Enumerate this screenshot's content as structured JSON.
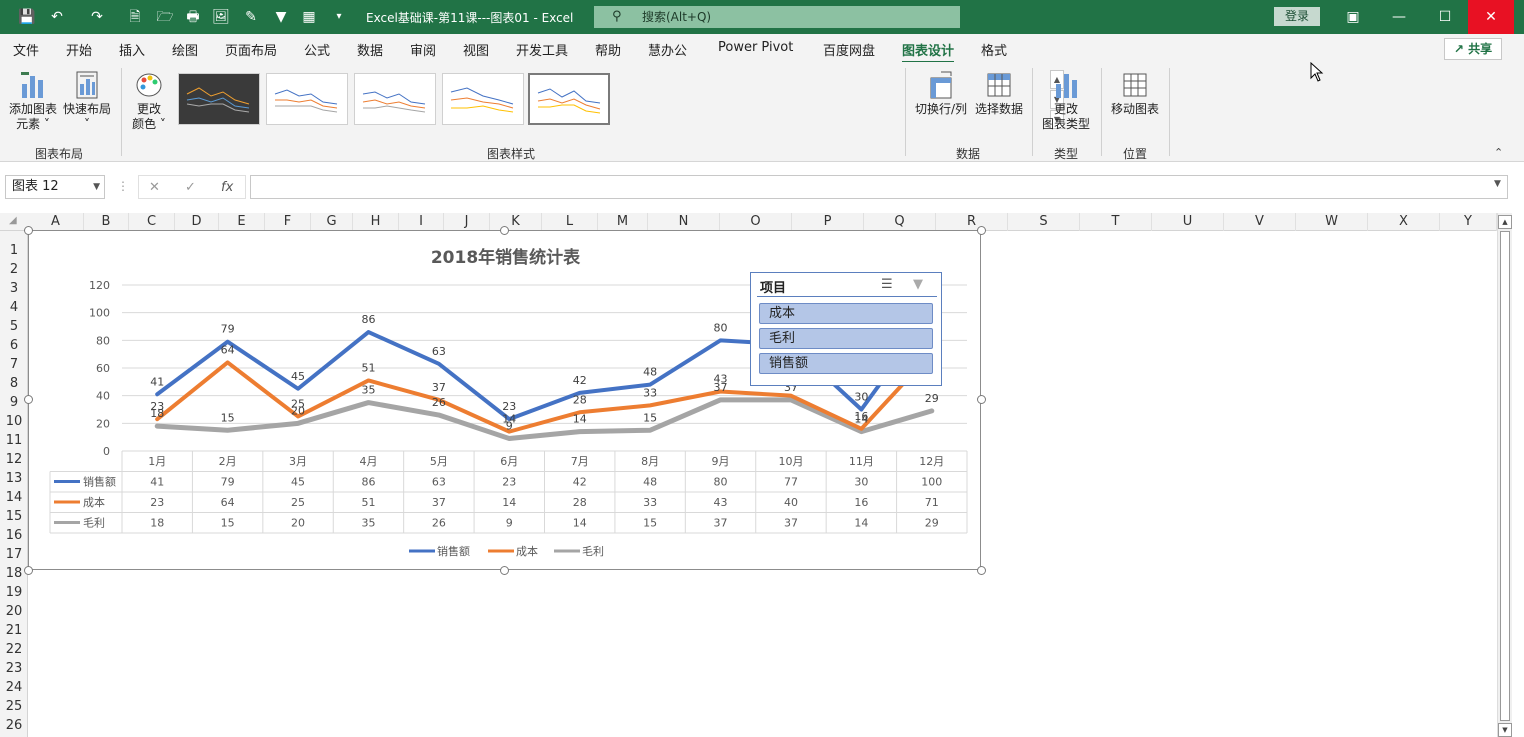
{
  "titlebar": {
    "doc_title": "Excel基础课-第11课---图表01  -  Excel",
    "search_placeholder": "搜索(Alt+Q)",
    "login": "登录"
  },
  "menu": {
    "items": [
      "文件",
      "开始",
      "插入",
      "绘图",
      "页面布局",
      "公式",
      "数据",
      "审阅",
      "视图",
      "开发工具",
      "帮助",
      "慧办公",
      "Power Pivot",
      "百度网盘",
      "图表设计",
      "格式"
    ],
    "active": "图表设计",
    "share": "共享"
  },
  "ribbon": {
    "add_element": [
      "添加图表",
      "元素 ˅"
    ],
    "quick_layout": [
      "快速布局",
      "˅"
    ],
    "change_color": [
      "更改",
      "颜色 ˅"
    ],
    "switch_row_col": "切换行/列",
    "select_data": "选择数据",
    "change_type": [
      "更改",
      "图表类型"
    ],
    "move_chart": "移动图表",
    "groups": {
      "layout": "图表布局",
      "styles": "图表样式",
      "data": "数据",
      "type": "类型",
      "location": "位置"
    }
  },
  "formula_bar": {
    "name_box": "图表 12",
    "fx": "fx",
    "formula": ""
  },
  "columns": [
    "A",
    "B",
    "C",
    "D",
    "E",
    "F",
    "G",
    "H",
    "I",
    "J",
    "K",
    "L",
    "M",
    "N",
    "O",
    "P",
    "Q",
    "R",
    "S",
    "T",
    "U",
    "V",
    "W",
    "X",
    "Y"
  ],
  "rows": [
    "1",
    "2",
    "3",
    "4",
    "5",
    "6",
    "7",
    "8",
    "9",
    "10",
    "11",
    "12",
    "13",
    "14",
    "15",
    "16",
    "17",
    "18",
    "19",
    "20",
    "21",
    "22",
    "23",
    "24",
    "25",
    "26"
  ],
  "slicer": {
    "title": "项目",
    "items": [
      "成本",
      "毛利",
      "销售额"
    ]
  },
  "chart_data": {
    "type": "line",
    "title": "2018年销售统计表",
    "categories": [
      "1月",
      "2月",
      "3月",
      "4月",
      "5月",
      "6月",
      "7月",
      "8月",
      "9月",
      "10月",
      "11月",
      "12月"
    ],
    "ylim": [
      0,
      120
    ],
    "yticks": [
      0,
      20,
      40,
      60,
      80,
      100,
      120
    ],
    "grid": true,
    "legend": "bottom",
    "data_table": true,
    "series": [
      {
        "name": "销售额",
        "color": "#4472c4",
        "values": [
          41,
          79,
          45,
          86,
          63,
          23,
          42,
          48,
          80,
          77,
          30,
          100
        ]
      },
      {
        "name": "成本",
        "color": "#ed7d31",
        "values": [
          23,
          64,
          25,
          51,
          37,
          14,
          28,
          33,
          43,
          40,
          16,
          71
        ]
      },
      {
        "name": "毛利",
        "color": "#a5a5a5",
        "values": [
          18,
          15,
          20,
          35,
          26,
          9,
          14,
          15,
          37,
          37,
          14,
          29
        ]
      }
    ]
  },
  "colors": {
    "excel_green": "#217346",
    "accent_blue": "#4472c4",
    "accent_orange": "#ed7d31",
    "accent_gray": "#a5a5a5"
  }
}
